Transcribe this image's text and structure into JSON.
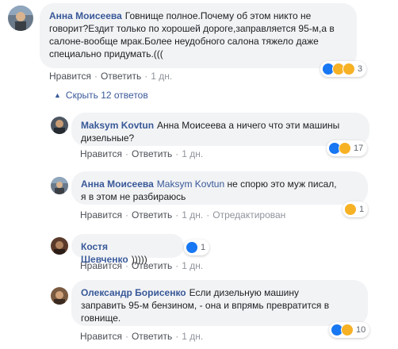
{
  "comments": [
    {
      "author": "Анна Моисеева",
      "text_lines": [
        "Говнище полное.Почему об этом никто не",
        "говорит?Ездит только по хорошей дороге,заправляется 95-м,а в",
        "салоне-вообще мрак.Более неудобного салона тяжело даже",
        "специально придумать.((("
      ],
      "like": "Нравится",
      "reply": "Ответить",
      "time": "1 дн.",
      "reaction_icons": [
        "like-icon",
        "haha-icon",
        "sad-icon"
      ],
      "reaction_count": "3"
    },
    {
      "author": "Maksym Kovtun",
      "text_lines": [
        "Анна Моисеева а ничего что эти машины",
        "дизельные?"
      ],
      "tag": "Анна Моисеева",
      "like": "Нравится",
      "reply": "Ответить",
      "time": "1 дн.",
      "reaction_icons": [
        "like-icon",
        "haha-icon"
      ],
      "reaction_count": "17"
    },
    {
      "author": "Анна Моисеева",
      "text_lines": [
        "Maksym Kovtun не спорю это муж писал,",
        "я в этом не разбираюсь"
      ],
      "tag": "Maksym Kovtun",
      "like": "Нравится",
      "reply": "Ответить",
      "time": "1 дн.",
      "edited": "Отредактирован",
      "reaction_icons": [
        "haha-icon"
      ],
      "reaction_count": "1"
    },
    {
      "author": "Костя Шевченко",
      "text_lines": [
        ")))))"
      ],
      "like": "Нравится",
      "reply": "Ответить",
      "time": "1 дн.",
      "reaction_icons": [
        "like-icon"
      ],
      "reaction_count": "1"
    },
    {
      "author": "Олександр Борисенко",
      "text_lines": [
        "Если дизельную машину",
        "заправить 95-м бензином, - она и впрямь превратится в",
        "говнище."
      ],
      "like": "Нравится",
      "reply": "Ответить",
      "time": "1 дн.",
      "reaction_icons": [
        "like-icon",
        "haha-icon"
      ],
      "reaction_count": "10"
    }
  ],
  "collapse_replies": "Скрыть 12 ответов",
  "colors": {
    "link": "#385898",
    "bubble": "#f2f3f5",
    "like": "#1877f2",
    "haha": "#f7b125"
  }
}
